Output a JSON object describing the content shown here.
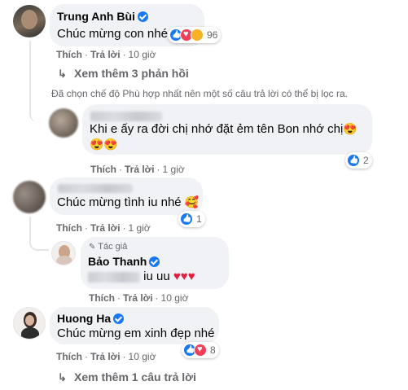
{
  "comments": [
    {
      "id": "c1",
      "name": "Trung Anh Bùi",
      "verified": true,
      "text": "Chúc mừng con nhé",
      "reaction_count": "96",
      "actions": {
        "like": "Thích",
        "reply": "Trả lời",
        "time": "10 giờ"
      }
    },
    {
      "id": "c1r",
      "text_line1": "Khi e ấy ra đời chị nhớ đặt ẻm tên Bon nhớ chị",
      "reaction_count": "2",
      "actions": {
        "like": "Thích",
        "reply": "Trả lời",
        "time": "1 giờ"
      }
    },
    {
      "id": "c2",
      "text": "Chúc mừng tình iu nhé",
      "reaction_count": "1",
      "actions": {
        "like": "Thích",
        "reply": "Trả lời",
        "time": "1 giờ"
      }
    },
    {
      "id": "c2r",
      "author_tag": "Tác giả",
      "name": "Bảo Thanh",
      "verified": true,
      "text": "iu uu",
      "actions": {
        "like": "Thích",
        "reply": "Trả lời",
        "time": "10 giờ"
      }
    },
    {
      "id": "c3",
      "name": "Huong Ha",
      "verified": true,
      "text": "Chúc mừng em xinh đẹp nhé",
      "reaction_count": "8",
      "actions": {
        "like": "Thích",
        "reply": "Trả lời",
        "time": "10 giờ"
      }
    }
  ],
  "view_more_replies_1": "Xem thêm 3 phản hồi",
  "filter_note": "Đã chọn chế độ Phù hợp nhất nên một số câu trả lời có thể bị lọc ra.",
  "view_more_replies_2": "Xem thêm 1 câu trả lời",
  "colors": {
    "link_blue": "#1877f2",
    "bubble_bg": "#f0f2f5",
    "meta_gray": "#65676b",
    "heart_red": "#e41e3f"
  },
  "icons": [
    "verified-badge-icon",
    "like-reaction-icon",
    "love-reaction-icon",
    "care-reaction-icon",
    "reply-arrow-icon",
    "author-pen-icon"
  ]
}
